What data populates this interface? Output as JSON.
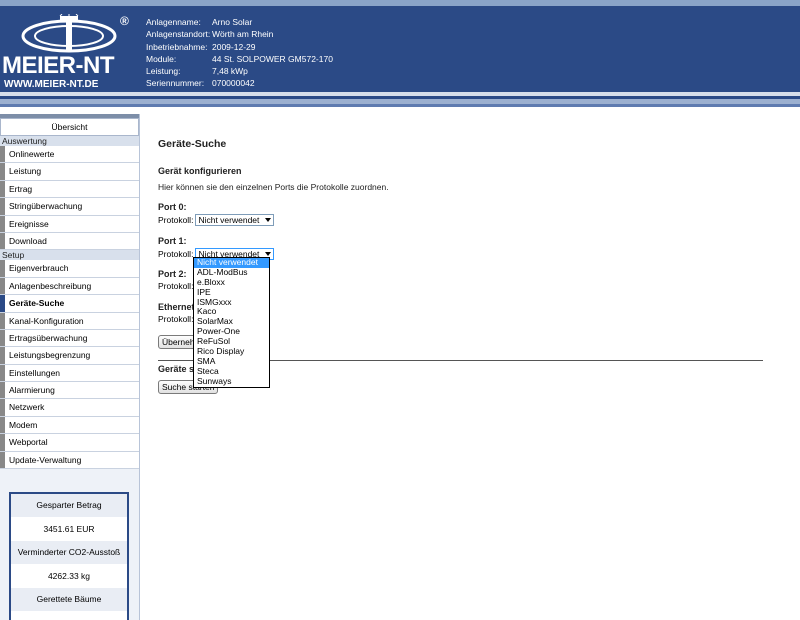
{
  "header": {
    "brand": "MEIER-NT",
    "url": "WWW.MEIER-NT.DE",
    "reg": "®",
    "info": [
      {
        "label": "Anlagenname:",
        "value": "Arno Solar"
      },
      {
        "label": "Anlagenstandort:",
        "value": "Wörth am Rhein"
      },
      {
        "label": "Inbetriebnahme:",
        "value": "2009-12-29"
      },
      {
        "label": "Module:",
        "value": "44 St. SOLPOWER GM572-170"
      },
      {
        "label": "Leistung:",
        "value": "7,48 kWp"
      },
      {
        "label": "Seriennummer:",
        "value": "070000042"
      }
    ]
  },
  "sidebar": {
    "overview": "Übersicht",
    "section_auswertung": "Auswertung",
    "auswertung_items": [
      "Onlinewerte",
      "Leistung",
      "Ertrag",
      "Stringüberwachung",
      "Ereignisse",
      "Download"
    ],
    "section_setup": "Setup",
    "setup_items": [
      "Eigenverbrauch",
      "Anlagenbeschreibung",
      "Geräte-Suche",
      "Kanal-Konfiguration",
      "Ertragsüberwachung",
      "Leistungsbegrenzung",
      "Einstellungen",
      "Alarmierung",
      "Netzwerk",
      "Modem",
      "Webportal",
      "Update-Verwaltung"
    ],
    "active": "Geräte-Suche",
    "savings": {
      "saved_label": "Gesparter Betrag",
      "saved_value": "3451.61 EUR",
      "co2_label": "Verminderter CO2-Ausstoß",
      "co2_value": "4262.33 kg",
      "trees_label": "Gerettete Bäume"
    }
  },
  "main": {
    "title": "Geräte-Suche",
    "subtitle": "Gerät konfigurieren",
    "description": "Hier können sie den einzelnen Ports die Protokolle zuordnen.",
    "protocol_label": "Protokoll:",
    "ports": [
      {
        "label": "Port 0:",
        "value": "Nicht verwendet"
      },
      {
        "label": "Port 1:",
        "value": "Nicht verwendet"
      },
      {
        "label": "Port 2:",
        "value": ""
      },
      {
        "label": "Ethernet",
        "value": ""
      }
    ],
    "apply_button": "Übernehmen",
    "apply_button_visible": "Übernehm",
    "search_heading": "Geräte s",
    "search_button": "Suche starten"
  },
  "dropdown": {
    "options": [
      "Nicht verwendet",
      "ADL-ModBus",
      "e.Bloxx",
      "IPE",
      "ISMGxxx",
      "Kaco",
      "SolarMax",
      "Power-One",
      "ReFuSol",
      "Rico Display",
      "SMA",
      "Steca",
      "Sunways"
    ],
    "selected": "Nicht verwendet"
  },
  "colors": {
    "header_bg": "#2b4a86",
    "selection": "#3399ff",
    "sidebar_bg": "#eef2f8"
  }
}
